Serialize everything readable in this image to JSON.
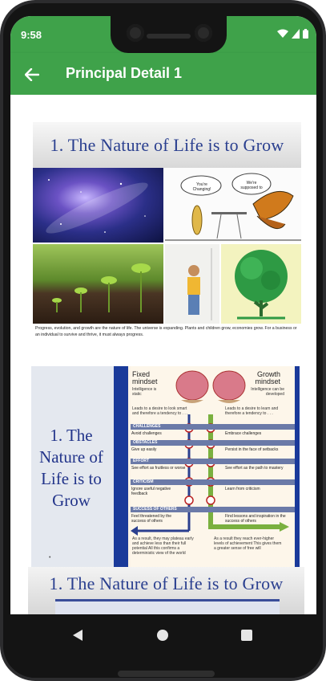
{
  "status": {
    "time": "9:58"
  },
  "appbar": {
    "title": "Principal Detail 1"
  },
  "slide1": {
    "title": "1. The Nature of Life is to Grow",
    "caption": "Progress, evolution, and growth are the nature of life. The universe is expanding. Plants and children grow, economies grow. For a business or an individual to survive and thrive, it must always progress.",
    "bubble_left": "You're Changing!",
    "bubble_right": "We're supposed to"
  },
  "slide2": {
    "title": "1. The Nature of Life is to Grow",
    "fixed": {
      "heading": "Fixed mindset",
      "sub": "Intelligence is static",
      "tendency": "Leads to a desire to look smart and therefore a tendency to . . ."
    },
    "growth": {
      "heading": "Growth mindset",
      "sub": "Intelligence can be developed",
      "tendency": "Leads to a desire to learn and therefore a tendency to . . ."
    },
    "rows": [
      {
        "label": "CHALLENGES",
        "left": "Avoid challenges",
        "right": "Embrace challenges"
      },
      {
        "label": "OBSTACLES",
        "left": "Give up easily",
        "right": "Persist in the face of setbacks"
      },
      {
        "label": "EFFORT",
        "left": "See effort as fruitless or worse",
        "right": "See effort as the path to mastery"
      },
      {
        "label": "CRITICISM",
        "left": "Ignore useful negative feedback",
        "right": "Learn from criticism"
      },
      {
        "label": "SUCCESS OF OTHERS",
        "left": "Feel threatened by the success of others",
        "right": "Find lessons and inspiration in the success of others"
      }
    ],
    "result_left": "As a result, they may plateau early and achieve less than their full potential All this confirms a deterministic view of the world",
    "result_right": "As a result they reach ever-higher levels of achievement This gives them a greater sense of free will"
  },
  "slide3": {
    "title": "1. The Nature of Life is to Grow"
  },
  "nav": {
    "back": "back-triangle-icon",
    "home": "home-circle-icon",
    "recents": "recents-square-icon"
  },
  "colors": {
    "app_green": "#3fa24a",
    "title_blue": "#2a3f8f"
  }
}
